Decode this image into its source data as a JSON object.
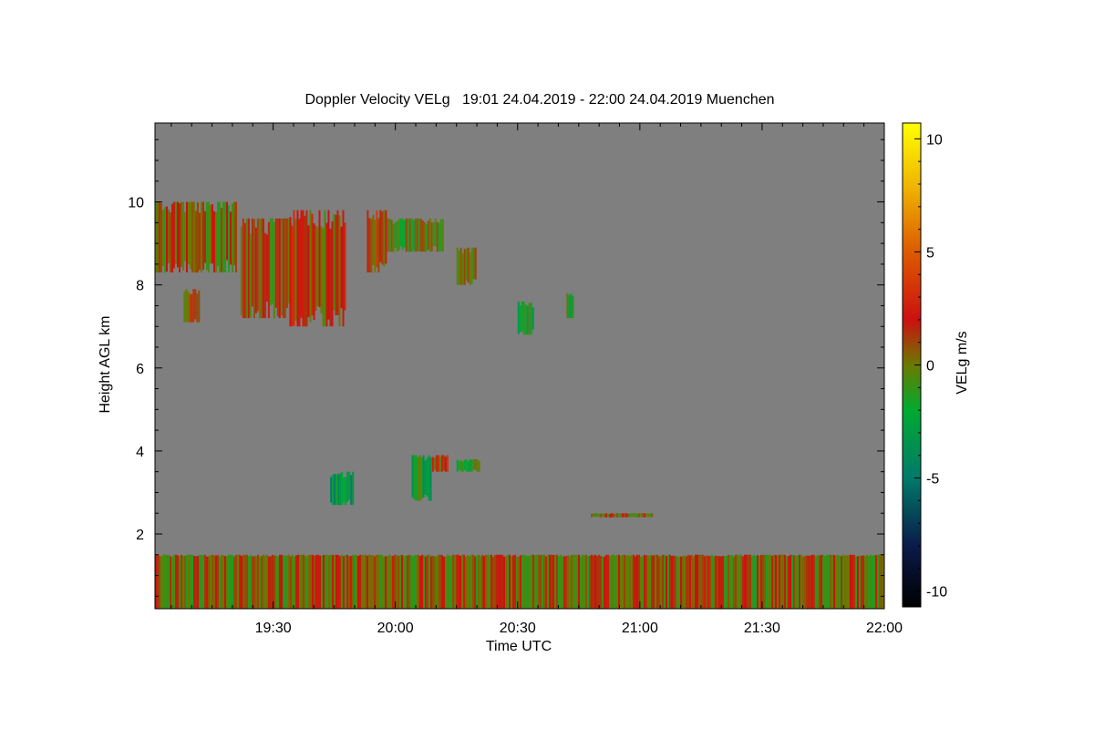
{
  "chart_data": {
    "type": "heatmap",
    "title": "Doppler Velocity VELg   19:01 24.04.2019 - 22:00 24.04.2019 Muenchen",
    "xlabel": "Time UTC",
    "ylabel": "Height AGL km",
    "colorbar_label": "VELg m/s",
    "x_ticks": [
      {
        "value": 29,
        "label": "19:30"
      },
      {
        "value": 59,
        "label": "20:00"
      },
      {
        "value": 89,
        "label": "20:30"
      },
      {
        "value": 119,
        "label": "21:00"
      },
      {
        "value": 149,
        "label": "21:30"
      },
      {
        "value": 179,
        "label": "22:00"
      }
    ],
    "xlim": [
      0,
      179
    ],
    "y_ticks": [
      2,
      4,
      6,
      8,
      10
    ],
    "ylim": [
      0.2,
      11.9
    ],
    "colorbar_ticks": [
      -10,
      -5,
      0,
      5,
      10
    ],
    "clim": [
      -10.7,
      10.7
    ],
    "no_data_color": "#7f7f7f",
    "colormap": [
      {
        "v": -10.7,
        "color": "#000000"
      },
      {
        "v": -8.0,
        "color": "#0a1a4a"
      },
      {
        "v": -5.0,
        "color": "#007a6a"
      },
      {
        "v": -2.0,
        "color": "#00aa30"
      },
      {
        "v": 0.0,
        "color": "#6a7a00"
      },
      {
        "v": 2.0,
        "color": "#cc1010"
      },
      {
        "v": 5.0,
        "color": "#dd5a00"
      },
      {
        "v": 8.0,
        "color": "#f0b800"
      },
      {
        "v": 10.7,
        "color": "#ffff00"
      }
    ],
    "echo_regions": [
      {
        "t": [
          0,
          20
        ],
        "h": [
          8.3,
          10.0
        ],
        "v": 0.3
      },
      {
        "t": [
          7,
          11
        ],
        "h": [
          7.1,
          7.9
        ],
        "v": 1.5
      },
      {
        "t": [
          21,
          37
        ],
        "h": [
          7.2,
          9.6
        ],
        "v": 0.8
      },
      {
        "t": [
          33,
          47
        ],
        "h": [
          7.0,
          9.8
        ],
        "v": 1.2
      },
      {
        "t": [
          52,
          57
        ],
        "h": [
          8.3,
          9.8
        ],
        "v": 1.8
      },
      {
        "t": [
          57,
          71
        ],
        "h": [
          8.8,
          9.6
        ],
        "v": -0.5
      },
      {
        "t": [
          74,
          79
        ],
        "h": [
          8.0,
          8.9
        ],
        "v": 0.5
      },
      {
        "t": [
          89,
          93
        ],
        "h": [
          6.8,
          7.6
        ],
        "v": -1.5
      },
      {
        "t": [
          101,
          103
        ],
        "h": [
          7.2,
          7.8
        ],
        "v": -1.5
      },
      {
        "t": [
          43,
          49
        ],
        "h": [
          2.7,
          3.5
        ],
        "v": -3.0
      },
      {
        "t": [
          63,
          68
        ],
        "h": [
          2.8,
          3.9
        ],
        "v": -2.0
      },
      {
        "t": [
          68,
          72
        ],
        "h": [
          3.5,
          3.9
        ],
        "v": 1.5
      },
      {
        "t": [
          74,
          80
        ],
        "h": [
          3.5,
          3.8
        ],
        "v": -1.0
      },
      {
        "t": [
          107,
          122
        ],
        "h": [
          2.4,
          2.5
        ],
        "v": 0.2
      },
      {
        "t": [
          0,
          179
        ],
        "h": [
          0.2,
          1.5
        ],
        "v": 0.5
      }
    ]
  }
}
